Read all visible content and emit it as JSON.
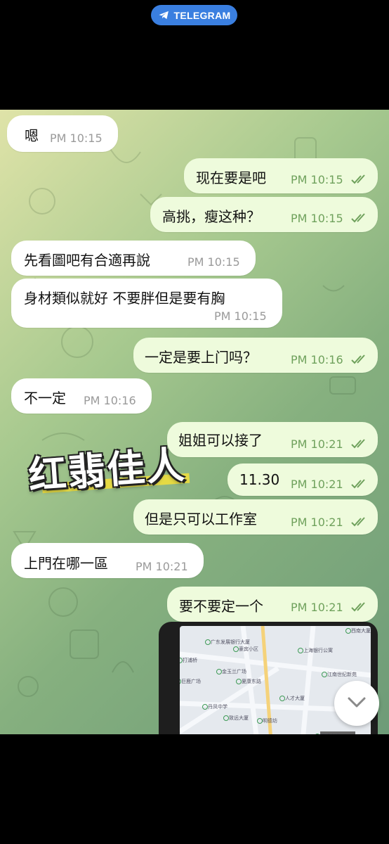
{
  "header": {
    "app_label": "TELEGRAM"
  },
  "watermark": {
    "text": "红翡佳人"
  },
  "messages": [
    {
      "dir": "in",
      "text": "嗯",
      "time": "PM 10:15"
    },
    {
      "dir": "out",
      "text": "现在要是吧",
      "time": "PM 10:15",
      "read": true
    },
    {
      "dir": "out",
      "text": "高挑，瘦这种？",
      "time": "PM 10:15",
      "read": true
    },
    {
      "dir": "in",
      "text": "先看圖吧有合適再說",
      "time": "PM 10:15"
    },
    {
      "dir": "in",
      "text": "身材類似就好 不要胖但是要有胸",
      "time": "PM 10:15"
    },
    {
      "dir": "out",
      "text": "一定是要上门吗？",
      "time": "PM 10:16",
      "read": true
    },
    {
      "dir": "in",
      "text": "不一定",
      "time": "PM 10:16"
    },
    {
      "dir": "out",
      "text": "姐姐可以接了",
      "time": "PM 10:21",
      "read": true
    },
    {
      "dir": "out",
      "text": "11.30",
      "time": "PM 10:21",
      "read": true
    },
    {
      "dir": "out",
      "text": "但是只可以工作室",
      "time": "PM 10:21",
      "read": true
    },
    {
      "dir": "in",
      "text": "上門在哪一區",
      "time": "PM 10:21"
    },
    {
      "dir": "out",
      "text": "要不要定一个",
      "time": "PM 10:21",
      "read": true
    }
  ],
  "map_photo": {
    "labels": [
      "广东发展银行大厦",
      "豪宾小区",
      "上海银行公寓",
      "打浦桥",
      "金玉兰广场",
      "巨鹿广场",
      "夏康东路",
      "江南世纪新苑",
      "人才大厦",
      "丹凤中学",
      "致远大厦",
      "明德坊",
      "西南大厦",
      "四轉大道"
    ]
  },
  "colors": {
    "incoming_bubble": "#ffffff",
    "outgoing_bubble": "#eefbdc",
    "outgoing_time": "#6fa15c",
    "incoming_time": "#9a9a9a",
    "header_pill": "#3a7fe0"
  },
  "icons": {
    "pill": "telegram-plane-icon",
    "read": "double-check-icon",
    "scroll": "chevron-down-icon"
  }
}
